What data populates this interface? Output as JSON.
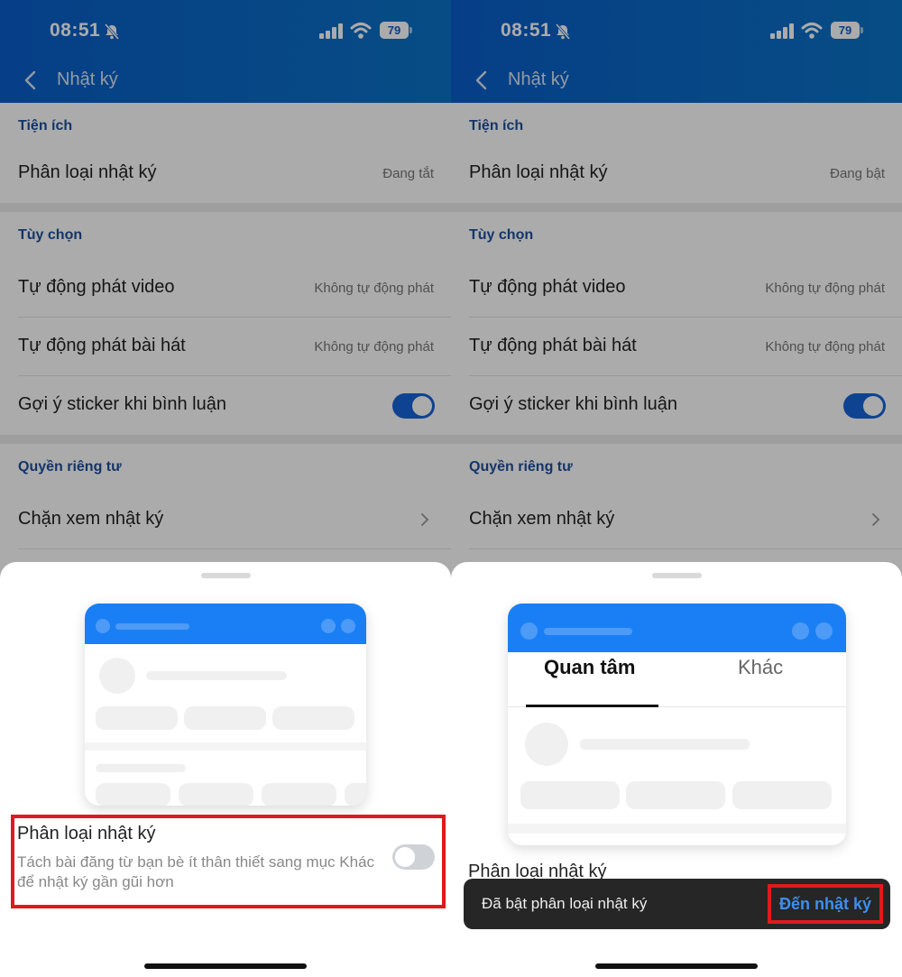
{
  "screens": [
    {
      "status": {
        "time": "08:51",
        "battery": "79"
      },
      "header": {
        "title": "Nhật ký"
      },
      "sections": {
        "utilities": {
          "label": "Tiện ích",
          "row_label": "Phân loại nhật ký",
          "row_value": "Đang tắt"
        },
        "options": {
          "label": "Tùy chọn",
          "autoplay_video_label": "Tự động phát video",
          "autoplay_video_value": "Không tự động phát",
          "autoplay_song_label": "Tự động phát bài hát",
          "autoplay_song_value": "Không tự động phát",
          "sticker_label": "Gợi ý sticker khi bình luận",
          "sticker_enabled": true
        },
        "privacy": {
          "label": "Quyền riêng tư",
          "block_label": "Chặn xem nhật ký"
        }
      },
      "sheet": {
        "feature_title": "Phân loại nhật ký",
        "feature_description": "Tách bài đăng từ bạn bè ít thân thiết sang mục Khác để nhật ký gần gũi hơn",
        "feature_enabled": false
      }
    },
    {
      "status": {
        "time": "08:51",
        "battery": "79"
      },
      "header": {
        "title": "Nhật ký"
      },
      "sections": {
        "utilities": {
          "label": "Tiện ích",
          "row_label": "Phân loại nhật ký",
          "row_value": "Đang bật"
        },
        "options": {
          "label": "Tùy chọn",
          "autoplay_video_label": "Tự động phát video",
          "autoplay_video_value": "Không tự động phát",
          "autoplay_song_label": "Tự động phát bài hát",
          "autoplay_song_value": "Không tự động phát",
          "sticker_label": "Gợi ý sticker khi bình luận",
          "sticker_enabled": true
        },
        "privacy": {
          "label": "Quyền riêng tư",
          "block_label": "Chặn xem nhật ký"
        }
      },
      "sheet": {
        "tabs": [
          "Quan tâm",
          "Khác"
        ],
        "active_tab": "Quan tâm",
        "feature_title": "Phân loại nhật ký",
        "toast_text": "Đã bật phân loại nhật ký",
        "toast_action": "Đến nhật ký"
      }
    }
  ],
  "colors": {
    "header": "#0a5ec9",
    "accent": "#1565d8",
    "highlight": "#e0191e",
    "card_header": "#1a7ff5"
  }
}
